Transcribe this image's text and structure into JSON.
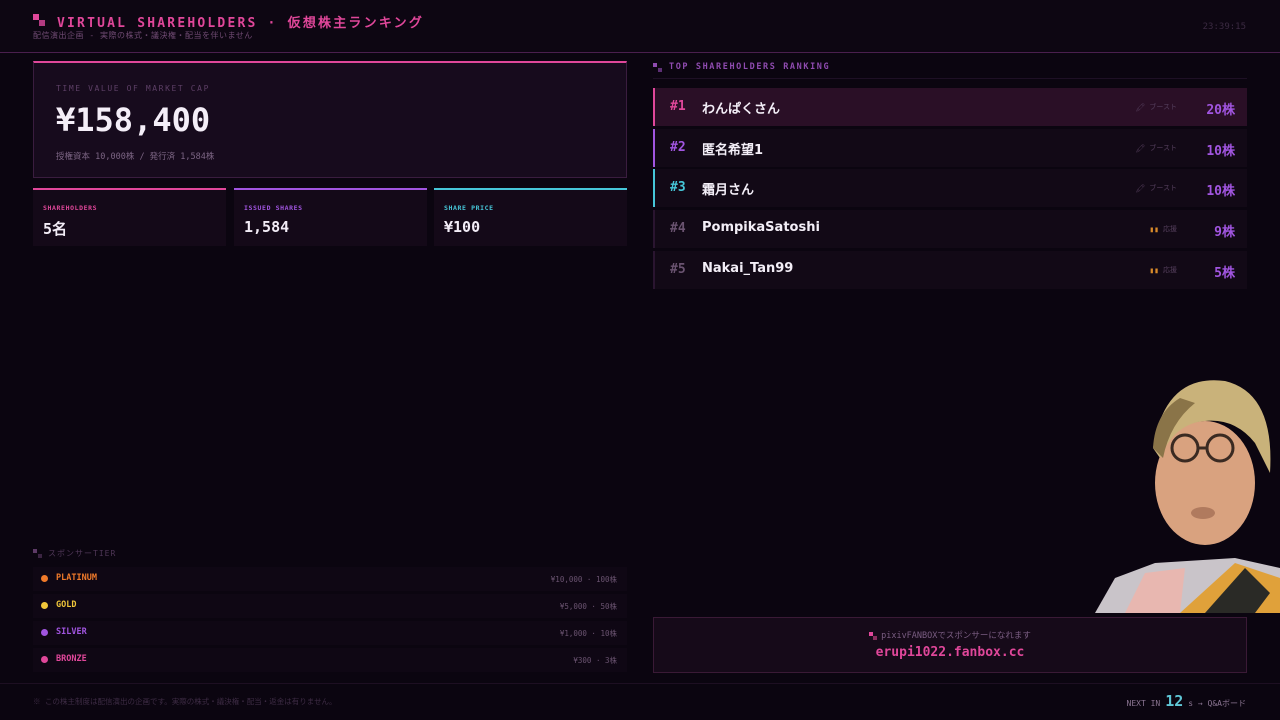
{
  "header": {
    "title": "VIRTUAL SHAREHOLDERS · 仮想株主ランキング",
    "subtitle": "配信演出企画 - 実際の株式・議決権・配当を伴いません",
    "clock": "23:39:15"
  },
  "market_cap": {
    "label": "TIME VALUE OF MARKET CAP",
    "value": "¥158,400",
    "note": "授権資本 10,000株 / 発行済 1,584株"
  },
  "stats": [
    {
      "label": "SHAREHOLDERS",
      "value": "5名",
      "color": "#e0479a"
    },
    {
      "label": "ISSUED SHARES",
      "value": "1,584",
      "color": "#a155e0"
    },
    {
      "label": "SHARE PRICE",
      "value": "¥100",
      "color": "#46c6d8"
    }
  ],
  "tiers": {
    "heading": "スポンサーTIER",
    "items": [
      {
        "name": "PLATINUM",
        "price": "¥10,000 · 100株",
        "color": "#f07a2a"
      },
      {
        "name": "GOLD",
        "price": "¥5,000 · 50株",
        "color": "#f0c63a"
      },
      {
        "name": "SILVER",
        "price": "¥1,000 · 10株",
        "color": "#a155e0"
      },
      {
        "name": "BRONZE",
        "price": "¥300 · 3株",
        "color": "#e0479a"
      }
    ]
  },
  "ranking": {
    "heading": "TOP SHAREHOLDERS RANKING",
    "rows": [
      {
        "pos": "#1",
        "name": "わんぱくさん",
        "badge_icon": "rocket-icon",
        "badge": "ブースト",
        "shares": "20株",
        "pos_color": "#e0479a"
      },
      {
        "pos": "#2",
        "name": "匿名希望1",
        "badge_icon": "rocket-icon",
        "badge": "ブースト",
        "shares": "10株",
        "pos_color": "#a155e0"
      },
      {
        "pos": "#3",
        "name": "霜月さん",
        "badge_icon": "rocket-icon",
        "badge": "ブースト",
        "shares": "10株",
        "pos_color": "#46c6d8"
      },
      {
        "pos": "#4",
        "name": "PompikaSatoshi",
        "badge_icon": "pause-icon",
        "badge": "応援",
        "shares": "9株",
        "pos_color": "#6a5370"
      },
      {
        "pos": "#5",
        "name": "Nakai_Tan99",
        "badge_icon": "pause-icon",
        "badge": "応援",
        "shares": "5株",
        "pos_color": "#6a5370"
      }
    ]
  },
  "sponsor": {
    "cta": "pixivFANBOXでスポンサーになれます",
    "url": "erupi1022.fanbox.cc"
  },
  "footer": {
    "note": "※ この株主制度は配信演出の企画です。実際の株式・議決権・配当・返金は有りません。",
    "next_prefix": "NEXT IN",
    "next_seconds": "12",
    "next_suffix": "s → Q&Aボード"
  }
}
